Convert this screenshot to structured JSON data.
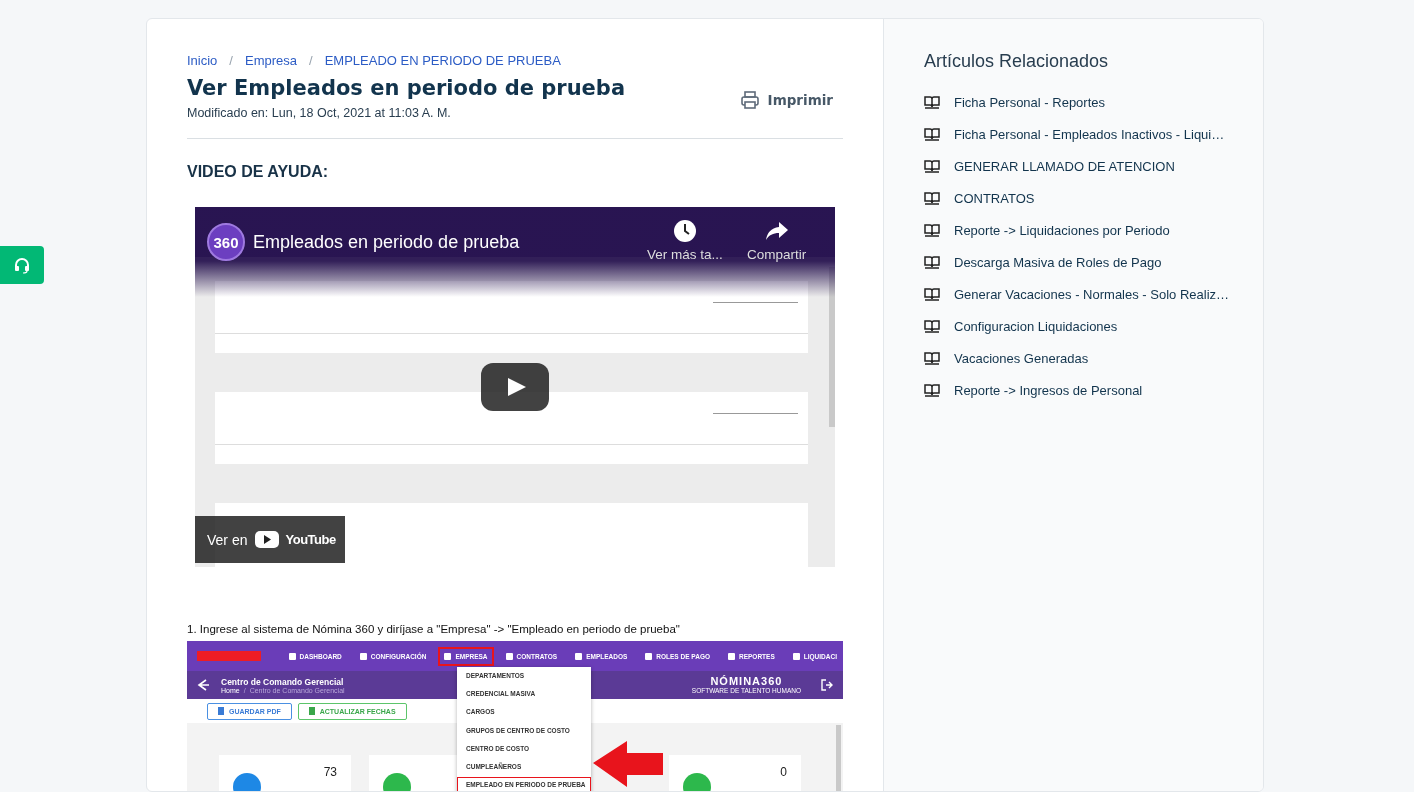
{
  "breadcrumb": [
    "Inicio",
    "Empresa",
    "EMPLEADO EN PERIODO DE PRUEBA"
  ],
  "breadcrumb_separator": "/",
  "title": "Ver Empleados en periodo de prueba",
  "modified": "Modificado en: Lun, 18 Oct, 2021 at 11:03 A. M.",
  "print_button": "Imprimir",
  "section_heading": "VIDEO DE AYUDA:",
  "video": {
    "kind": "picture",
    "channel_badge": "360",
    "title": "Empleados en periodo de prueba",
    "watch_later": "Ver más ta...",
    "share": "Compartir",
    "watch_on": "Ver en",
    "platform": "YouTube"
  },
  "step_text": "1. Ingrese al sistema de Nómina 360 y diríjase a \"Empresa\" -> \"Empleado en periodo de prueba\"",
  "step_screenshot": {
    "nav": [
      {
        "label": "DASHBOARD",
        "selected": false
      },
      {
        "label": "CONFIGURACIÓN",
        "selected": false
      },
      {
        "label": "EMPRESA",
        "selected": true
      },
      {
        "label": "CONTRATOS",
        "selected": false
      },
      {
        "label": "EMPLEADOS",
        "selected": false
      },
      {
        "label": "ROLES DE PAGO",
        "selected": false
      },
      {
        "label": "REPORTES",
        "selected": false
      },
      {
        "label": "LIQUIDACI",
        "selected": false
      }
    ],
    "page_title": "Centro de Comando Gerencial",
    "breadcrumb": [
      "Home",
      "Centro de Comando Gerencial"
    ],
    "breadcrumb_separator": "/",
    "logo": "NÓMINA360",
    "logo_tagline": "SOFTWARE DE TALENTO HUMANO",
    "buttons": [
      {
        "label": "GUARDAR PDF",
        "kind": "pdf"
      },
      {
        "label": "ACTUALIZAR FECHAS",
        "kind": "sheet"
      }
    ],
    "menu": [
      {
        "label": "DEPARTAMENTOS",
        "selected": false
      },
      {
        "label": "CREDENCIAL MASIVA",
        "selected": false
      },
      {
        "label": "CARGOS",
        "selected": false
      },
      {
        "label": "GRUPOS DE CENTRO DE COSTO",
        "selected": false
      },
      {
        "label": "CENTRO DE COSTO",
        "selected": false
      },
      {
        "label": "CUMPLEAÑEROS",
        "selected": false
      },
      {
        "label": "EMPLEADO EN PERIODO DE PRUEBA",
        "selected": true
      }
    ],
    "cards": [
      {
        "kind": "value",
        "value": "73"
      },
      {
        "kind": "blank"
      },
      {
        "kind": "value",
        "value": "0"
      }
    ]
  },
  "related": {
    "title": "Artículos Relacionados",
    "items": [
      "Ficha Personal - Reportes",
      "Ficha Personal - Empleados Inactivos - Liqui…",
      "GENERAR LLAMADO DE ATENCION",
      "CONTRATOS",
      "Reporte -> Liquidaciones por Periodo",
      "Descarga Masiva de Roles de Pago",
      "Generar Vacaciones - Normales - Solo Realiz…",
      "Configuracion Liquidaciones",
      "Vacaciones Generadas",
      "Reporte -> Ingresos de Personal"
    ]
  }
}
